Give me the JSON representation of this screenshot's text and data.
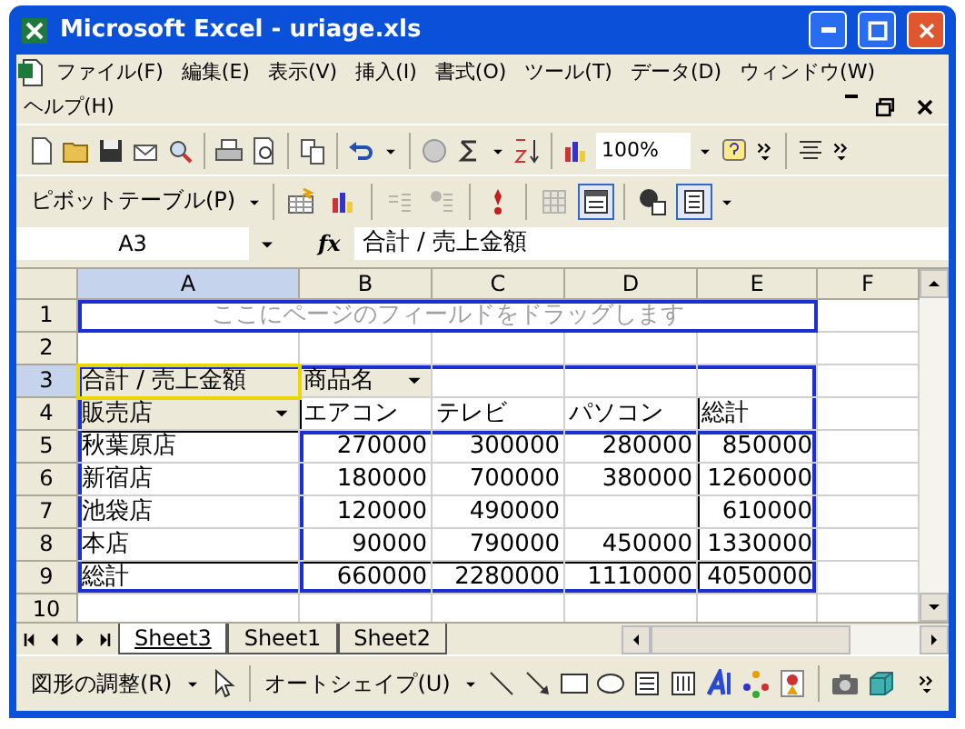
{
  "window": {
    "title": "Microsoft Excel - uriage.xls"
  },
  "menu": [
    "ファイル(F)",
    "編集(E)",
    "表示(V)",
    "挿入(I)",
    "書式(O)",
    "ツール(T)",
    "データ(D)",
    "ウィンドウ(W)",
    "ヘルプ(H)"
  ],
  "standard_toolbar": {
    "zoom": "100%"
  },
  "pivot_toolbar": {
    "menu": "ピボットテーブル(P)",
    "buttons": [
      {
        "disabled": false,
        "pressed": false
      },
      {
        "disabled": false,
        "pressed": false
      },
      {
        "disabled": true,
        "pressed": false
      },
      {
        "disabled": true,
        "pressed": false
      },
      {
        "disabled": false,
        "pressed": false
      },
      {
        "disabled": true,
        "pressed": false
      },
      {
        "disabled": false,
        "pressed": true
      },
      {
        "disabled": false,
        "pressed": false
      },
      {
        "disabled": false,
        "pressed": true
      }
    ]
  },
  "formula_bar": {
    "name_box": "A3",
    "function_label": "fx",
    "formula": "合計 / 売上金額"
  },
  "sheet": {
    "columns": [
      {
        "label": "A",
        "selected": true
      },
      {
        "label": "B",
        "selected": false
      },
      {
        "label": "C",
        "selected": false
      },
      {
        "label": "D",
        "selected": false
      },
      {
        "label": "E",
        "selected": false
      },
      {
        "label": "F",
        "selected": false
      }
    ],
    "rows": [
      {
        "number": "1",
        "selected": false,
        "cells": [
          {
            "kind": "hint",
            "text": "ここにページのフィールドをドラッグします",
            "selected": false
          }
        ]
      },
      {
        "number": "2",
        "selected": false,
        "cells": []
      },
      {
        "number": "3",
        "selected": true,
        "cells": [
          {
            "kind": "field",
            "text": "合計 / 売上金額",
            "selected": true
          },
          {
            "kind": "field-dropdown",
            "text": "商品名",
            "selected": false
          }
        ]
      },
      {
        "number": "4",
        "selected": false,
        "cells": [
          {
            "kind": "field-dropdown",
            "text": "販売店",
            "selected": false
          },
          {
            "kind": "label",
            "text": "エアコン",
            "selected": false
          },
          {
            "kind": "label",
            "text": "テレビ",
            "selected": false
          },
          {
            "kind": "label",
            "text": "パソコン",
            "selected": false
          },
          {
            "kind": "label",
            "text": "総計",
            "selected": false
          }
        ]
      },
      {
        "number": "5",
        "selected": false,
        "cells": [
          {
            "kind": "label",
            "text": "秋葉原店",
            "selected": false
          },
          {
            "kind": "number",
            "text": "270000",
            "selected": false
          },
          {
            "kind": "number",
            "text": "300000",
            "selected": false
          },
          {
            "kind": "number",
            "text": "280000",
            "selected": false
          },
          {
            "kind": "number",
            "text": "850000",
            "selected": false
          }
        ]
      },
      {
        "number": "6",
        "selected": false,
        "cells": [
          {
            "kind": "label",
            "text": "新宿店",
            "selected": false
          },
          {
            "kind": "number",
            "text": "180000",
            "selected": false
          },
          {
            "kind": "number",
            "text": "700000",
            "selected": false
          },
          {
            "kind": "number",
            "text": "380000",
            "selected": false
          },
          {
            "kind": "number",
            "text": "1260000",
            "selected": false
          }
        ]
      },
      {
        "number": "7",
        "selected": false,
        "cells": [
          {
            "kind": "label",
            "text": "池袋店",
            "selected": false
          },
          {
            "kind": "number",
            "text": "120000",
            "selected": false
          },
          {
            "kind": "number",
            "text": "490000",
            "selected": false
          },
          {
            "kind": "number",
            "text": "",
            "selected": false
          },
          {
            "kind": "number",
            "text": "610000",
            "selected": false
          }
        ]
      },
      {
        "number": "8",
        "selected": false,
        "cells": [
          {
            "kind": "label",
            "text": "本店",
            "selected": false
          },
          {
            "kind": "number",
            "text": "90000",
            "selected": false
          },
          {
            "kind": "number",
            "text": "790000",
            "selected": false
          },
          {
            "kind": "number",
            "text": "450000",
            "selected": false
          },
          {
            "kind": "number",
            "text": "1330000",
            "selected": false
          }
        ]
      },
      {
        "number": "9",
        "selected": false,
        "cells": [
          {
            "kind": "label",
            "text": "総計",
            "selected": false
          },
          {
            "kind": "number",
            "text": "660000",
            "selected": false
          },
          {
            "kind": "number",
            "text": "2280000",
            "selected": false
          },
          {
            "kind": "number",
            "text": "1110000",
            "selected": false
          },
          {
            "kind": "number",
            "text": "4050000",
            "selected": false
          }
        ]
      },
      {
        "number": "10",
        "selected": false,
        "cells": []
      }
    ]
  },
  "sheet_tabs": [
    {
      "label": "Sheet3",
      "selected": true
    },
    {
      "label": "Sheet1",
      "selected": false
    },
    {
      "label": "Sheet2",
      "selected": false
    }
  ],
  "drawing_toolbar": {
    "draw_menu": "図形の調整(R)",
    "autoshapes_menu": "オートシェイプ(U)"
  }
}
